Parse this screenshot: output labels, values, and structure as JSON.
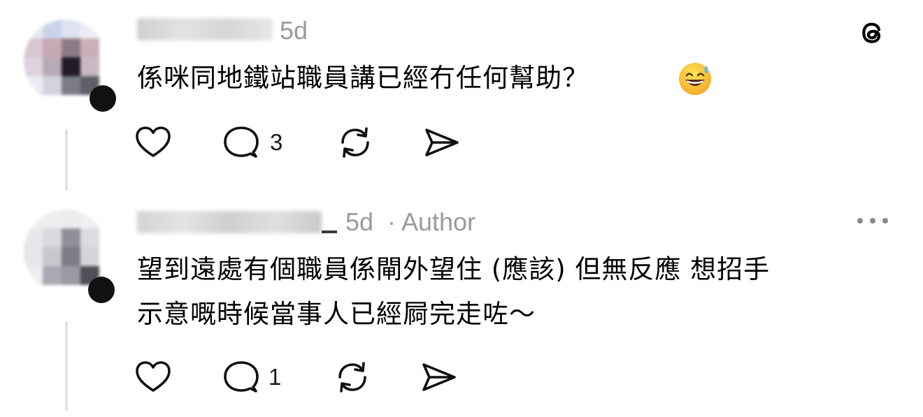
{
  "posts": [
    {
      "time": "5d",
      "author_badge": "",
      "text": "係咪同地鐵站職員講已經冇任何幫助？",
      "emoji": "grinning-face-with-sweat-emoji",
      "reply_count": "3",
      "top_right_icon": "threads-logo-icon"
    },
    {
      "time": "5d",
      "author_badge": "· Author",
      "text_line1": "望到遠處有個職員係閘外望住 (應該) 但無反應 想招手",
      "text_line2": "示意嘅時候當事人已經屙完走咗～",
      "reply_count": "1",
      "top_right_icon": "more-options-icon"
    }
  ]
}
